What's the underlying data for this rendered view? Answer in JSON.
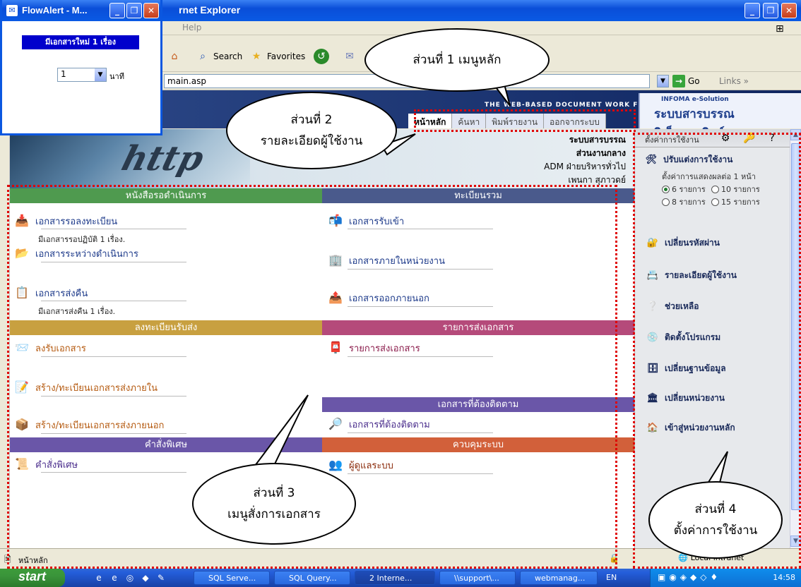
{
  "browser": {
    "title": "rnet Explorer",
    "menu_help": "Help",
    "toolbar": {
      "search": "Search",
      "favorites": "Favorites"
    },
    "address": "main.asp",
    "go": "Go",
    "links": "Links",
    "status": "หน้าหลัก",
    "zone": "Local intranet"
  },
  "header": {
    "tagline": "THE WEB-BASED DOCUMENT WORK FLOW",
    "brand_small": "INFOMA e-Solution",
    "brand_main": "ระบบสารบรรณอิเล็กทรอนิกส์",
    "nav": [
      "หน้าหลัก",
      "ค้นหา",
      "พิมพ์รายงาน",
      "ออกจากระบบ"
    ]
  },
  "user": {
    "banner_word": "http",
    "line1": "ระบบสารบรรณ",
    "line2": "ส่วนงานกลาง",
    "line3": "ADM ฝ่ายบริหารทั่วไป",
    "line4": "เพนกา สุภาวดย์"
  },
  "content": {
    "sections": {
      "pending": "หนังสือรอดำเนินการ",
      "registry": "ทะเบียนรวม",
      "register_send": "ลงทะเบียนรับส่ง",
      "send_list": "รายการส่งเอกสาร",
      "tracking": "เอกสารที่ต้องติดตาม",
      "special": "คำสั่งพิเศษ",
      "system": "ควบคุมระบบ"
    },
    "items": {
      "await_register": "เอกสารรอลงทะเบียน",
      "await_register_sub": "มีเอกสารรอปฏิบัติ 1 เรื่อง.",
      "in_progress": "เอกสารระหว่างดำเนินการ",
      "returned": "เอกสารส่งคืน",
      "returned_sub": "มีเอกสารส่งคืน 1 เรื่อง.",
      "received": "เอกสารรับเข้า",
      "internal": "เอกสารภายในหน่วยงาน",
      "external": "เอกสารออกภายนอก",
      "receive_register": "ลงรับเอกสาร",
      "create_internal": "สร้าง/ทะเบียนเอกสารส่งภายใน",
      "create_external": "สร้าง/ทะเบียนเอกสารส่งภายนอก",
      "send_docs": "รายการส่งเอกสาร",
      "tracked_docs": "เอกสารที่ต้องติดตาม",
      "special_cmd": "คำสั่งพิเศษ",
      "sys_admin": "ผู้ดูแลระบบ"
    }
  },
  "settings": {
    "header": "ตั้งค่าการใช้งาน",
    "customize": "ปรับแต่งการใช้งาน",
    "per_page_label": "ตั้งค่าการแสดงผลต่อ 1 หน้า",
    "options": [
      "6 รายการ",
      "10 รายการ",
      "8 รายการ",
      "15 รายการ"
    ],
    "selected": "6 รายการ",
    "items": [
      "เปลี่ยนรหัสผ่าน",
      "รายละเอียดผู้ใช้งาน",
      "ช่วยเหลือ",
      "ติดตั้งโปรแกรม",
      "เปลี่ยนฐานข้อมูล",
      "เปลี่ยนหน่วยงาน",
      "เข้าสู่หน่วยงานหลัก"
    ]
  },
  "flowalert": {
    "title": "FlowAlert - M...",
    "banner": "มีเอกสารใหม่ 1 เรื่อง",
    "interval": "1",
    "unit": "นาที"
  },
  "taskbar": {
    "start": "start",
    "buttons": [
      "SQL Serve...",
      "SQL Query...",
      "2 Interne...",
      "\\\\support\\...",
      "webmanag..."
    ],
    "lang": "EN",
    "clock": "14:58"
  },
  "callouts": {
    "c1": "ส่วนที่ 1 เมนูหลัก",
    "c2a": "ส่วนที่ 2",
    "c2b": "รายละเอียดผู้ใช้งาน",
    "c3a": "ส่วนที่ 3",
    "c3b": "เมนูสั่งการเอกสาร",
    "c4a": "ส่วนที่ 4",
    "c4b": "ตั้งค่าการใช้งาน"
  },
  "colors": {
    "green_section": "#4f9a4f",
    "navy_section": "#4a5a8c",
    "gold_section": "#c8a040",
    "magenta_section": "#b54a7a",
    "purple_section": "#6a56a8",
    "orange_section": "#d2603a",
    "callout_dots": "#e00000"
  }
}
